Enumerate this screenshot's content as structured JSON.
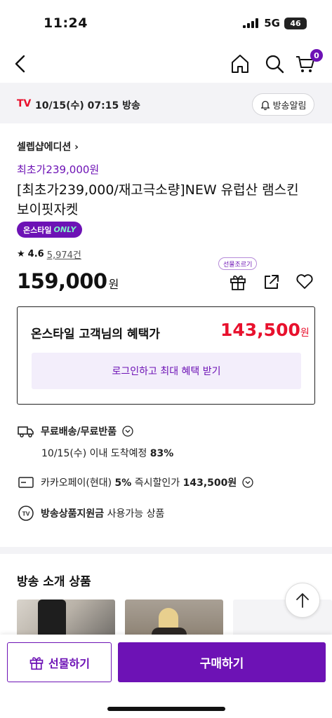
{
  "status": {
    "time": "11:24",
    "network": "5G",
    "battery": "46"
  },
  "header": {
    "cart_count": "0"
  },
  "broadcast": {
    "tv_label": "TV",
    "time": "10/15(수) 07:15 방송",
    "alarm_label": "방송알림"
  },
  "product": {
    "brand": "셀렙샵에디션",
    "promo": "최초가239,000원",
    "title": "[최초가239,000/재고극소량]NEW 유럽산 램스킨 보이핏자켓",
    "badge_main": "온스타일",
    "badge_only": "ONLY",
    "rating": "4.6",
    "review_count": "5,974건",
    "price": "159,000",
    "currency": "원",
    "gift_tooltip": "선물조르기"
  },
  "benefit": {
    "label": "온스타일 고객님의 혜택가",
    "price": "143,500",
    "currency": "원",
    "login_label": "로그인하고 최대 혜택 받기"
  },
  "info": {
    "shipping": "무료배송/무료반품",
    "delivery_text": "10/15(수) 이내 도착예정",
    "delivery_rate": "83%",
    "card_prefix": "카카오페이(현대)",
    "card_rate": "5%",
    "card_mid": "즉시할인가",
    "card_price": "143,500원",
    "support_bold": "방송상품지원금",
    "support_text": "사용가능 상품",
    "tv_icon_text": "TV"
  },
  "section": {
    "title": "방송 소개 상품"
  },
  "bottom": {
    "gift_label": "선물하기",
    "buy_label": "구매하기"
  },
  "colors": {
    "brand_purple": "#6d12b5",
    "sale_red": "#e8112d"
  }
}
